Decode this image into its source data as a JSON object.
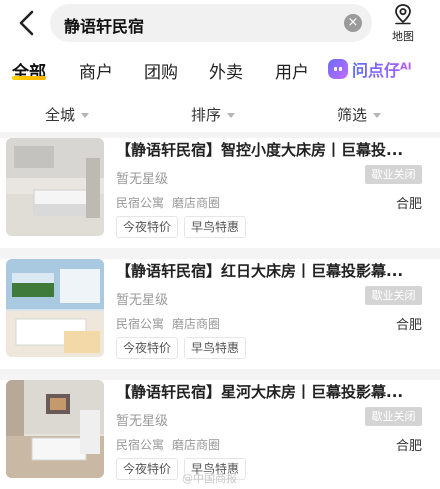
{
  "search": {
    "query": "静语轩民宿",
    "clear_icon": "clear-icon"
  },
  "map": {
    "label": "地图",
    "icon": "map-pin-icon"
  },
  "tabs": [
    {
      "label": "全部",
      "active": true
    },
    {
      "label": "商户"
    },
    {
      "label": "团购"
    },
    {
      "label": "外卖"
    },
    {
      "label": "用户"
    }
  ],
  "ai_tab": {
    "label": "问点仔",
    "badge": "AI"
  },
  "filters": [
    {
      "label": "全城"
    },
    {
      "label": "排序"
    },
    {
      "label": "筛选"
    }
  ],
  "results": [
    {
      "title": "【静语轩民宿】智控小度大床房丨巨幕投...",
      "stars": "暂无星级",
      "status": "歇业关闭",
      "category": "民宿公寓",
      "area": "磨店商圈",
      "city": "合肥",
      "tags": [
        "今夜特价",
        "早鸟特惠"
      ]
    },
    {
      "title": "【静语轩民宿】红日大床房丨巨幕投影幕...",
      "stars": "暂无星级",
      "status": "歇业关闭",
      "category": "民宿公寓",
      "area": "磨店商圈",
      "city": "合肥",
      "tags": [
        "今夜特价",
        "早鸟特惠"
      ]
    },
    {
      "title": "【静语轩民宿】星河大床房丨巨幕投影幕...",
      "stars": "暂无星级",
      "status": "歇业关闭",
      "category": "民宿公寓",
      "area": "磨店商圈",
      "city": "合肥",
      "tags": [
        "今夜特价",
        "早鸟特惠"
      ]
    }
  ],
  "watermark": "@中国商报",
  "colors": {
    "accent": "#ffc300",
    "ai": "#7b5bff",
    "status_bg": "#d4d4d4"
  }
}
